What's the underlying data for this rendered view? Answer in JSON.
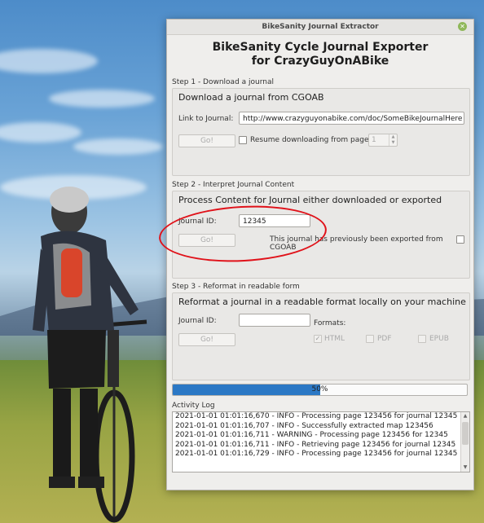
{
  "window": {
    "title": "BikeSanity Journal Extractor",
    "close_icon": "close-icon",
    "heading_line1": "BikeSanity Cycle Journal Exporter",
    "heading_line2": "for CrazyGuyOnABike"
  },
  "step1": {
    "label": "Step 1 - Download a journal",
    "group_title": "Download a journal from CGOAB",
    "link_label": "Link to Journal:",
    "link_value": "http://www.crazyguyonabike.com/doc/SomeBikeJournalHere",
    "go_label": "Go!",
    "resume_label": "Resume downloading from page:",
    "resume_checked": false,
    "page_value": "1"
  },
  "step2": {
    "label": "Step 2 - Interpret Journal Content",
    "group_title": "Process Content for Journal either downloaded or exported",
    "journal_id_label": "Journal ID:",
    "journal_id_value": "12345",
    "go_label": "Go!",
    "exported_label": "This journal has previously been exported from CGOAB",
    "exported_checked": false
  },
  "step3": {
    "label": "Step 3 - Reformat in readable form",
    "group_title": "Reformat a journal in a readable format locally on your machine",
    "journal_id_label": "Journal ID:",
    "journal_id_value": "",
    "formats_label": "Formats:",
    "go_label": "Go!",
    "formats": [
      {
        "label": "HTML",
        "checked": true
      },
      {
        "label": "PDF",
        "checked": false
      },
      {
        "label": "EPUB",
        "checked": false
      }
    ]
  },
  "progress": {
    "value": 0.5,
    "text": "50%",
    "color": "#2b78c5"
  },
  "activity_log": {
    "label": "Activity Log",
    "lines": [
      "2021-01-01 01:01:16,670 - INFO - Processing page 123456 for journal 12345",
      "2021-01-01 01:01:16,707 - INFO - Successfully extracted map 123456",
      "2021-01-01 01:01:16,711 - WARNING - Processing page 123456 for 12345",
      "2021-01-01 01:01:16,711 - INFO - Retrieving page 123456 for journal 12345",
      "2021-01-01 01:01:16,729 - INFO - Processing page 123456 for journal 12345"
    ]
  },
  "annotation_color": "#e0121a"
}
